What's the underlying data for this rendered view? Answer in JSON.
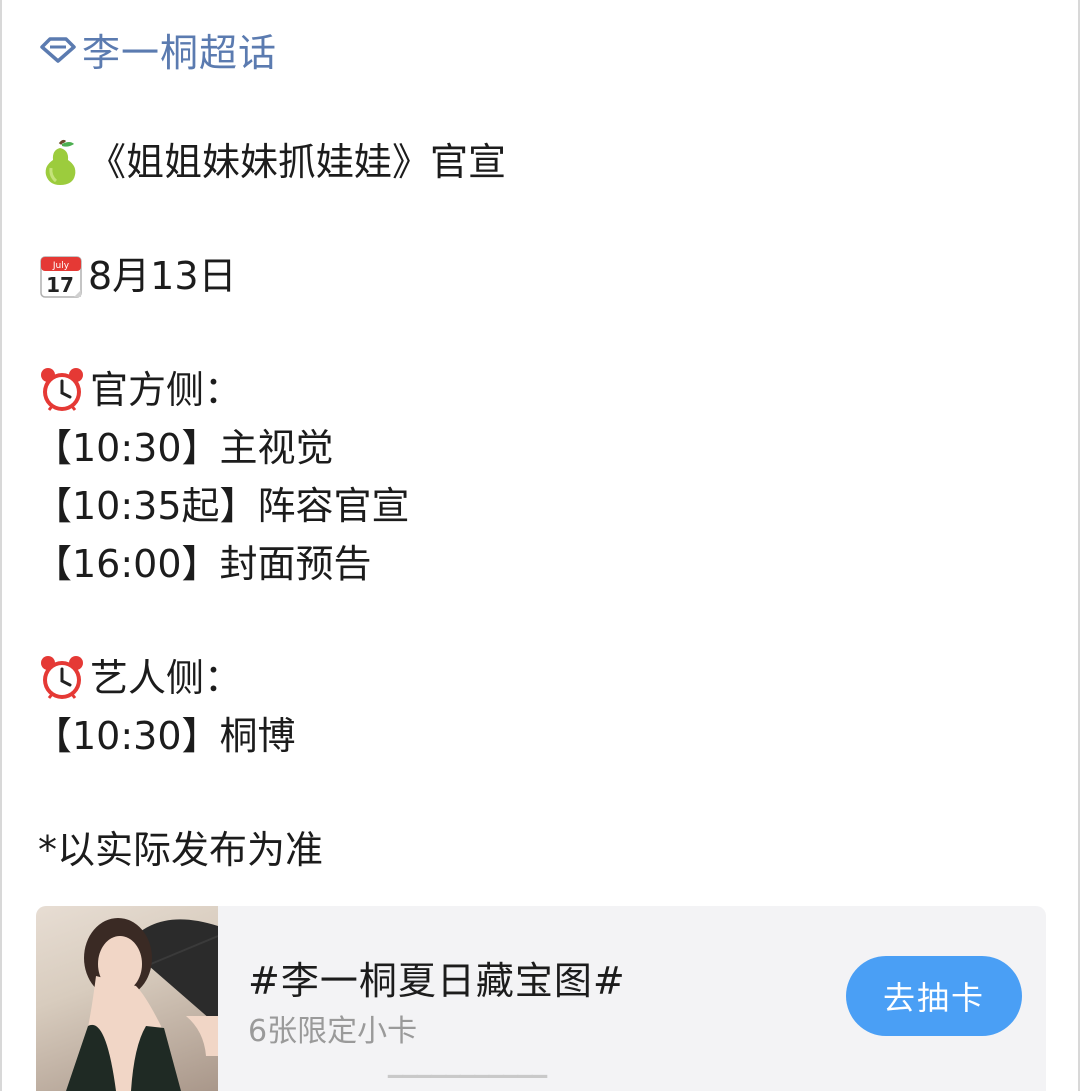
{
  "topic": {
    "icon": "super-topic-diamond-icon",
    "label": "李一桐超话",
    "color": "#5b7bb0"
  },
  "post": {
    "title_icon": "pear-emoji",
    "title": "《姐姐妹妹抓娃娃》官宣",
    "date_icon": "calendar-emoji",
    "date": "8月13日",
    "official_icon": "alarm-clock-emoji",
    "official_heading": "官方侧：",
    "official_items": [
      "【10:30】主视觉",
      "【10:35起】阵容官宣",
      "【16:00】封面预告"
    ],
    "artist_icon": "alarm-clock-emoji",
    "artist_heading": "艺人侧：",
    "artist_items": [
      "【10:30】桐博"
    ],
    "note": "*以实际发布为准"
  },
  "card": {
    "title": "#李一桐夏日藏宝图#",
    "subtitle": "6张限定小卡",
    "button_label": "去抽卡",
    "button_color": "#4a9ff5"
  }
}
